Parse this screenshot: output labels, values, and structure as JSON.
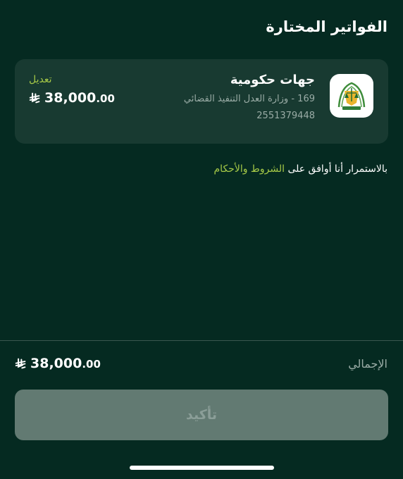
{
  "header": {
    "title": "الفواتير المختارة"
  },
  "bill": {
    "logo_icon": "ministry-of-justice-emblem",
    "name": "جهات حكومية",
    "description": "169 - وزارة العدل التنفيذ القضائي",
    "account_number": "2551379448",
    "edit_label": "تعديل",
    "amount_main": "38,000",
    "amount_cents": ".00",
    "currency_icon": "saudi-riyal-symbol"
  },
  "terms": {
    "prefix": "بالاستمرار أنا أوافق على",
    "link": "الشروط والأحكام"
  },
  "summary": {
    "total_label": "الإجمالي",
    "total_main": "38,000",
    "total_cents": ".00"
  },
  "actions": {
    "confirm_label": "تأكيد"
  },
  "colors": {
    "background": "#052a21",
    "card": "#183a31",
    "accent": "#a6c947",
    "button_disabled": "#627a72"
  }
}
